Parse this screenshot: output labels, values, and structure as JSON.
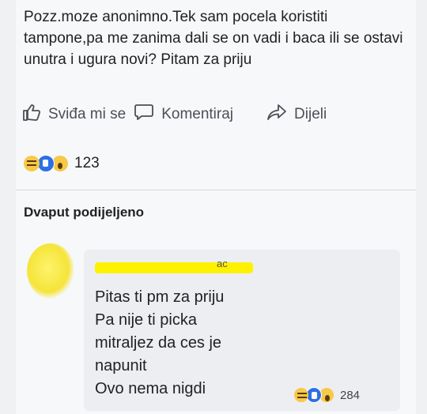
{
  "post": {
    "text": "Pozz.moze anonimno.Tek sam pocela koristiti tampone,pa me zanima dali se on vadi i baca ili se ostavi unutra i ugura novi? Pitam za priju"
  },
  "actions": {
    "like_label": "Sviđa mi se",
    "comment_label": "Komentiraj",
    "share_label": "Dijeli"
  },
  "reactions": {
    "icons": [
      "haha-icon",
      "like-icon",
      "wow-icon"
    ],
    "count": "123"
  },
  "shared": {
    "label": "Dvaput podijeljeno"
  },
  "reply": {
    "name_fragment": "ac",
    "lines": [
      "Pitas ti pm za priju",
      "Pa nije ti picka",
      "mitraljez da ces je",
      "napunit",
      "Ovo nema nigdi"
    ],
    "reactions": {
      "icons": [
        "haha-icon",
        "like-icon",
        "wow-icon"
      ],
      "count": "284"
    }
  },
  "colors": {
    "background": "#f7f8fa",
    "bubble": "#eceef1",
    "redaction": "#fff200",
    "like_blue": "#2f6fe4",
    "emoji_yellow": "#f7c948"
  }
}
